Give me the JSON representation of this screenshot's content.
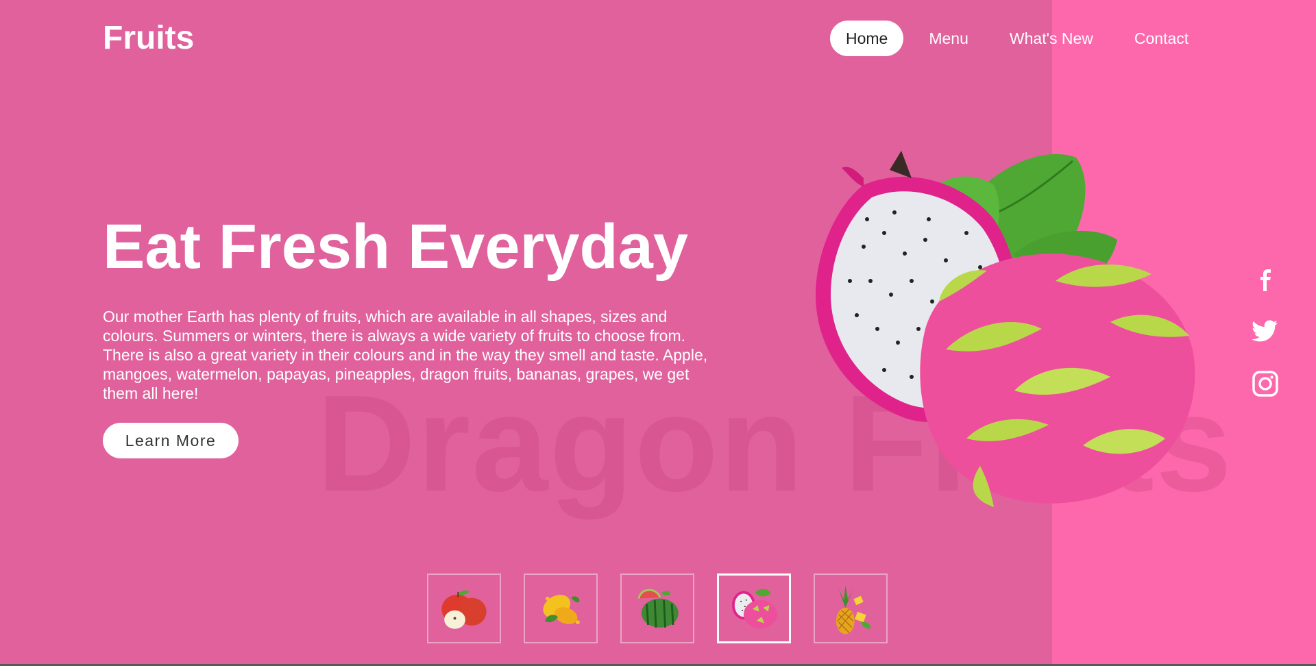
{
  "brand": {
    "logo": "Fruits"
  },
  "nav": [
    {
      "label": "Home",
      "active": true
    },
    {
      "label": "Menu",
      "active": false
    },
    {
      "label": "What's New",
      "active": false
    },
    {
      "label": "Contact",
      "active": false
    }
  ],
  "hero": {
    "headline": "Eat Fresh Everyday",
    "description": "Our mother Earth has plenty of fruits, which are available in all shapes, sizes and colours. Summers or winters, there is always a wide variety of fruits to choose from. There is also a great variety in their colours and in the way they smell and taste. Apple, mangoes, watermelon, papayas, pineapples, dragon fruits, bananas, grapes, we get them all here!",
    "button_label": "Learn More",
    "watermark": "Dragon Fruits",
    "image_icon": "dragon-fruit-icon"
  },
  "social": [
    {
      "icon": "facebook-icon"
    },
    {
      "icon": "twitter-icon"
    },
    {
      "icon": "instagram-icon"
    }
  ],
  "thumbnails": [
    {
      "icon": "apple-icon",
      "active": false
    },
    {
      "icon": "mango-icon",
      "active": false
    },
    {
      "icon": "watermelon-icon",
      "active": false
    },
    {
      "icon": "dragon-fruit-icon",
      "active": true
    },
    {
      "icon": "pineapple-icon",
      "active": false
    }
  ],
  "colors": {
    "background": "#e0619c",
    "accent_panel": "#fd68ac",
    "text": "#ffffff",
    "button_bg": "#ffffff",
    "button_text": "#333333"
  }
}
